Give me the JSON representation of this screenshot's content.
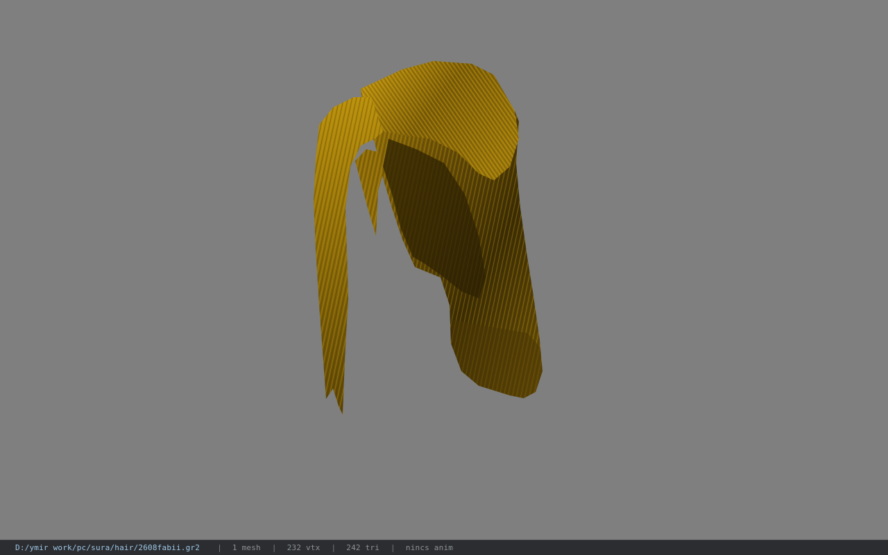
{
  "viewport": {
    "background_color": "#7f7f7f",
    "model": "hair-mesh",
    "hair_colors": [
      "#8a6a08",
      "#b8900c",
      "#3b2c05",
      "#d4a914"
    ]
  },
  "statusbar": {
    "file_path": "D:/ymir work/pc/sura/hair/2608fabii.gr2",
    "mesh_count": "1 mesh",
    "vertex_count": "232 vtx",
    "triangle_count": "242 tri",
    "anim_status": "nincs anim",
    "separator": "|"
  }
}
